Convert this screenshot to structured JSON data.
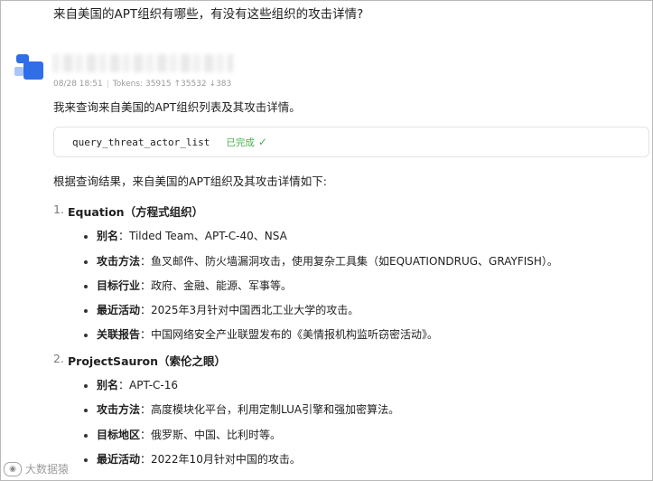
{
  "user_question": "来自美国的APT组织有哪些，有没有这些组织的攻击详情?",
  "meta": {
    "datetime": "08/28 18:51",
    "tokens": "Tokens: 35915",
    "up": "↑35532",
    "down": "↓383"
  },
  "intro": "我来查询来自美国的APT组织列表及其攻击详情。",
  "tool": {
    "name": "query_threat_actor_list",
    "status": "已完成"
  },
  "result_lead": "根据查询结果，来自美国的APT组织及其攻击详情如下:",
  "sections": [
    {
      "num": "1.",
      "title": "Equation（方程式组织）",
      "items": [
        {
          "label": "别名",
          "text": "：Tilded Team、APT-C-40、NSA"
        },
        {
          "label": "攻击方法",
          "text": "：鱼叉邮件、防火墙漏洞攻击，使用复杂工具集（如EQUATIONDRUG、GRAYFISH）。"
        },
        {
          "label": "目标行业",
          "text": "：政府、金融、能源、军事等。"
        },
        {
          "label": "最近活动",
          "text": "：2025年3月针对中国西北工业大学的攻击。"
        },
        {
          "label": "关联报告",
          "text": "：中国网络安全产业联盟发布的《美情报机构监听窃密活动》。"
        }
      ]
    },
    {
      "num": "2.",
      "title": "ProjectSauron（索伦之眼）",
      "items": [
        {
          "label": "别名",
          "text": "：APT-C-16"
        },
        {
          "label": "攻击方法",
          "text": "：高度模块化平台，利用定制LUA引擎和强加密算法。"
        },
        {
          "label": "目标地区",
          "text": "：俄罗斯、中国、比利时等。"
        },
        {
          "label": "最近活动",
          "text": "：2022年10月针对中国的攻击。"
        }
      ]
    }
  ],
  "watermark": "大数据猿"
}
